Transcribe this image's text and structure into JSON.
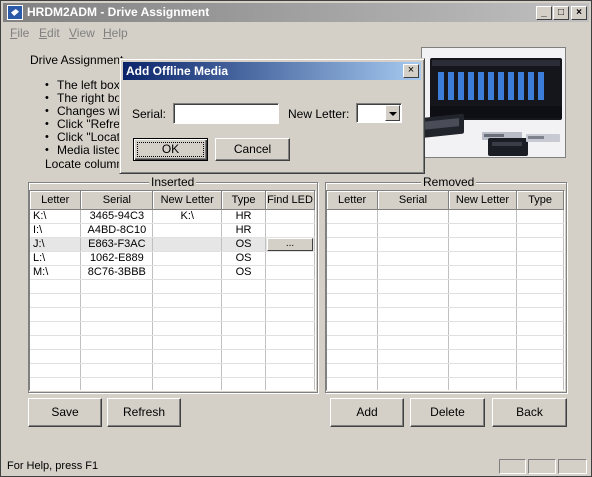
{
  "window": {
    "title": "HRDM2ADM - Drive Assignment",
    "minimize": "_",
    "maximize": "□",
    "close": "×"
  },
  "menu": [
    {
      "label": "File",
      "underline": "F",
      "rest": "ile"
    },
    {
      "label": "Edit",
      "underline": "E",
      "rest": "dit"
    },
    {
      "label": "View",
      "underline": "V",
      "rest": "iew"
    },
    {
      "label": "Help",
      "underline": "H",
      "rest": "elp"
    }
  ],
  "instructions": {
    "heading": "Drive Assignment",
    "bullets": [
      "The left box l",
      "The right box",
      "Changes will",
      "Click \"Refresh",
      "Click \"Locate\"",
      "Media listed w"
    ],
    "footer": "Locate column i"
  },
  "inserted": {
    "group_label": "Inserted",
    "columns": [
      "Letter",
      "Serial",
      "New Letter",
      "Type",
      "Find LED"
    ],
    "rows": [
      {
        "letter": "K:\\",
        "serial": "3465-94C3",
        "new_letter": "K:\\",
        "type": "HR",
        "find": ""
      },
      {
        "letter": "I:\\",
        "serial": "A4BD-8C10",
        "new_letter": "",
        "type": "HR",
        "find": ""
      },
      {
        "letter": "J:\\",
        "serial": "E863-F3AC",
        "new_letter": "",
        "type": "OS",
        "find": "..."
      },
      {
        "letter": "L:\\",
        "serial": "1062-E889",
        "new_letter": "",
        "type": "OS",
        "find": ""
      },
      {
        "letter": "M:\\",
        "serial": "8C76-3BBB",
        "new_letter": "",
        "type": "OS",
        "find": ""
      }
    ],
    "selected_row": 2
  },
  "removed": {
    "group_label": "Removed",
    "columns": [
      "Letter",
      "Serial",
      "New Letter",
      "Type"
    ],
    "rows": []
  },
  "buttons": {
    "save": "Save",
    "refresh": "Refresh",
    "add": "Add",
    "delete": "Delete",
    "back": "Back"
  },
  "status": {
    "text": "For Help, press F1"
  },
  "dialog": {
    "title": "Add Offline Media",
    "close": "×",
    "serial_label": "Serial:",
    "serial_value": "",
    "new_letter_label": "New Letter:",
    "new_letter_value": "",
    "ok": "OK",
    "cancel": "Cancel"
  }
}
